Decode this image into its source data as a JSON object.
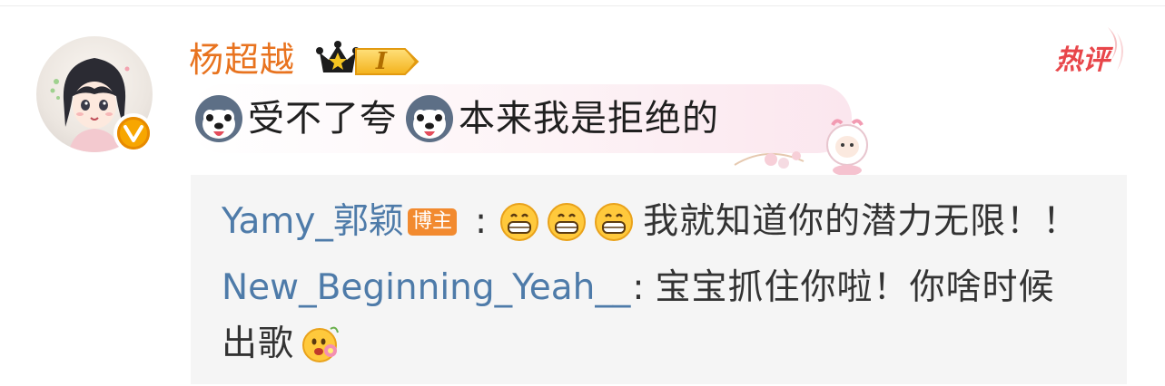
{
  "comment": {
    "username": "杨超越",
    "level_label": "I",
    "hot_label": "热评",
    "text_part1": "受不了夸",
    "text_part2": "本来我是拒绝的",
    "verified_label": "V"
  },
  "replies": [
    {
      "name": "Yamy_郭颖",
      "tag": "博主",
      "separator": ":",
      "text": "我就知道你的潜力无限！！"
    },
    {
      "name": "New_Beginning_Yeah__",
      "separator": ":",
      "text_line1": "宝宝抓住你啦！你啥时候",
      "text_line2": "出歌"
    }
  ],
  "colors": {
    "username": "#e8731f",
    "reply_name": "#4e7ba9",
    "hot": "#e8464a",
    "blogger_tag": "#f28a2f",
    "reply_bg": "#f5f5f5"
  },
  "icons": [
    "avatar",
    "verified-badge-icon",
    "crown-icon",
    "level-badge",
    "dog-emoji-icon",
    "grin-emoji-icon",
    "flower-emoji-icon",
    "hot-comment-badge",
    "sheep-decoration"
  ]
}
